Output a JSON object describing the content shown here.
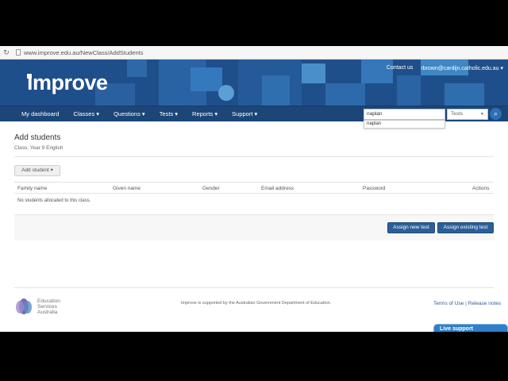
{
  "browser": {
    "url": "www.improve.edu.au/NewClass/AddStudents"
  },
  "header": {
    "logo": "improve",
    "contact_link": "Contact us",
    "user_menu": "rbrown@cardijn.catholic.edu.au"
  },
  "nav": {
    "items": [
      {
        "label": "My dashboard"
      },
      {
        "label": "Classes ▾"
      },
      {
        "label": "Questions ▾"
      },
      {
        "label": "Tests ▾"
      },
      {
        "label": "Reports ▾"
      },
      {
        "label": "Support ▾"
      }
    ],
    "search": {
      "value": "naplan",
      "suggestion": "naplan",
      "scope": "Tests"
    }
  },
  "page": {
    "title": "Add students",
    "class_label": "Class: Year 9 English",
    "add_button": "Add student ▾"
  },
  "table": {
    "columns": [
      "Family name",
      "Given name",
      "Gender",
      "Email address",
      "Password",
      "Actions"
    ],
    "empty_message": "No students allocated to this class."
  },
  "actions": {
    "assign_new": "Assign new test",
    "assign_existing": "Assign existing test"
  },
  "footer": {
    "org_line1": "Education",
    "org_line2": "Services",
    "org_line3": "Australia",
    "note": "Improve is supported by the Australian Government Department of Education.",
    "terms": "Terms of Use",
    "separator": "|",
    "release": "Release notes",
    "live_support": "Live support"
  },
  "colors": {
    "banner": "#1f4f8a",
    "nav": "#1d4678",
    "button": "#2b5f97",
    "link": "#2b5f97"
  }
}
